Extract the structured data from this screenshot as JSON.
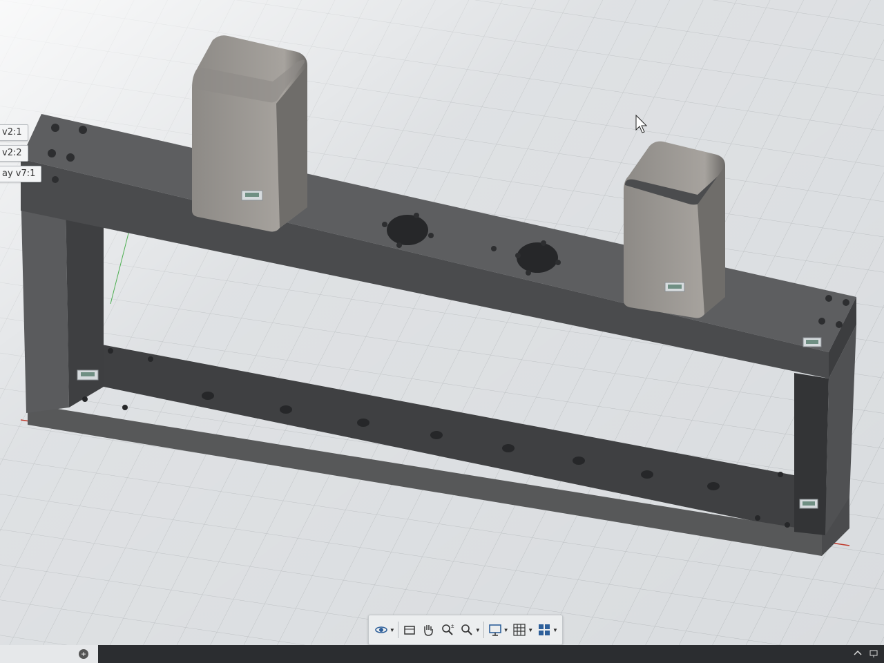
{
  "browser": {
    "items": [
      {
        "label": "v2:1"
      },
      {
        "label": "v2:2"
      },
      {
        "label": "ay v7:1"
      }
    ]
  },
  "navigation_toolbar": {
    "tools": [
      {
        "icon": "orbit-icon",
        "has_dropdown": true
      },
      {
        "icon": "look-at-icon",
        "has_dropdown": false
      },
      {
        "icon": "pan-hand-icon",
        "has_dropdown": false
      },
      {
        "icon": "zoom-icon",
        "has_dropdown": false
      },
      {
        "icon": "fit-zoom-icon",
        "has_dropdown": true
      },
      {
        "icon": "display-settings-icon",
        "has_dropdown": true
      },
      {
        "icon": "grid-snaps-icon",
        "has_dropdown": true
      },
      {
        "icon": "viewports-icon",
        "has_dropdown": true
      }
    ]
  },
  "colors": {
    "background": "#d9dcdf",
    "body_face": "#4d4e50",
    "body_top": "#5e5f61",
    "grid_line": "#b6babd",
    "x_axis": "#c0392b",
    "y_axis": "#4caf50"
  }
}
